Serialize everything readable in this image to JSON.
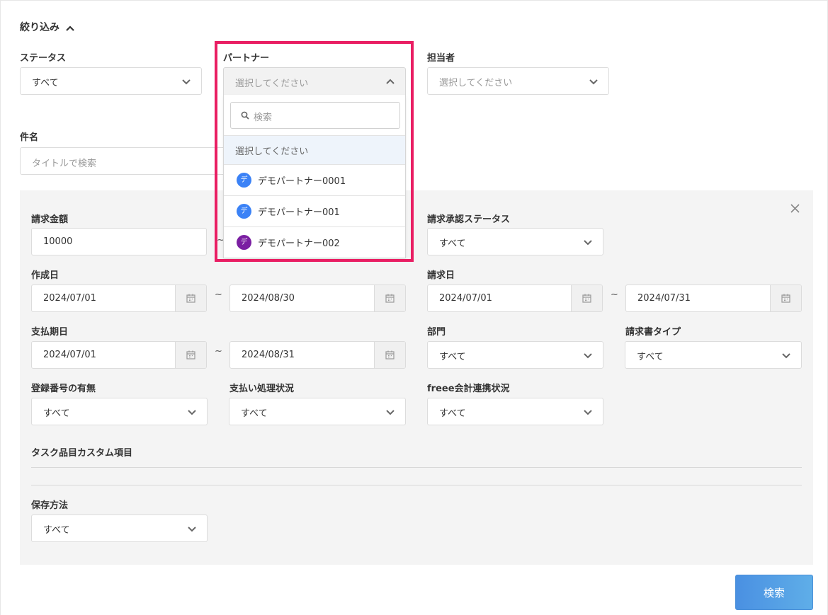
{
  "filter_toggle": {
    "label": "絞り込み"
  },
  "status": {
    "label": "ステータス",
    "value": "すべて"
  },
  "partner": {
    "label": "パートナー",
    "placeholder": "選択してください",
    "search_placeholder": "検索",
    "options": [
      {
        "label": "選択してください"
      },
      {
        "avatar": "デ",
        "label": "デモパートナー0001",
        "color": "#3b82f6"
      },
      {
        "avatar": "デ",
        "label": "デモパートナー001",
        "color": "#3b82f6"
      },
      {
        "avatar": "デ",
        "label": "デモパートナー002",
        "color": "#7b1fa2"
      }
    ]
  },
  "assignee": {
    "label": "担当者",
    "placeholder": "選択してください"
  },
  "subject": {
    "label": "件名",
    "placeholder": "タイトルで検索"
  },
  "advanced": {
    "amount": {
      "label": "請求金額",
      "value": "10000",
      "sep": "~"
    },
    "approval_status": {
      "label": "請求承認ステータス",
      "value": "すべて"
    },
    "created_date": {
      "label": "作成日",
      "from": "2024/07/01",
      "to": "2024/08/30",
      "sep": "~"
    },
    "invoice_date": {
      "label": "請求日",
      "from": "2024/07/01",
      "to": "2024/07/31",
      "sep": "~"
    },
    "due_date": {
      "label": "支払期日",
      "from": "2024/07/01",
      "to": "2024/08/31",
      "sep": "~"
    },
    "department": {
      "label": "部門",
      "value": "すべて"
    },
    "invoice_type": {
      "label": "請求書タイプ",
      "value": "すべて"
    },
    "registration": {
      "label": "登録番号の有無",
      "value": "すべて"
    },
    "payment_status": {
      "label": "支払い処理状況",
      "value": "すべて"
    },
    "freee_status": {
      "label": "freee会計連携状況",
      "value": "すべて"
    },
    "custom_items": {
      "label": "タスク品目カスタム項目"
    },
    "storage": {
      "label": "保存方法",
      "value": "すべて"
    }
  },
  "search_button": {
    "label": "検索"
  },
  "colors": {
    "highlight": "#e91e63",
    "accent": "#4a90e2",
    "panel": "#f4f4f4"
  },
  "icons": [
    "chevron-up-icon",
    "chevron-down-icon",
    "search-icon",
    "calendar-icon",
    "close-icon"
  ]
}
